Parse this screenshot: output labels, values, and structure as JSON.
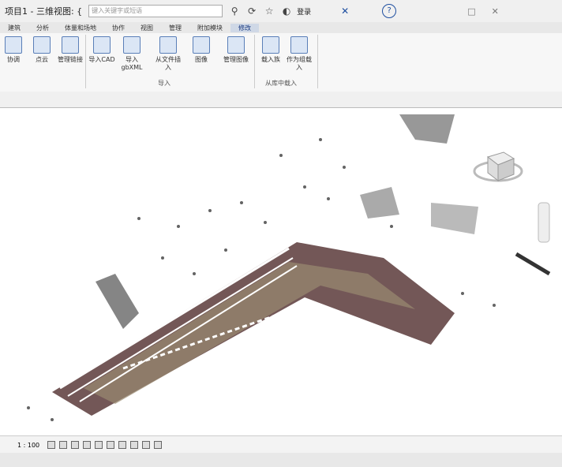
{
  "titlebar": {
    "title": "项目1 - 三维视图: {",
    "search_placeholder": "键入关键字或短语",
    "login": "登录",
    "help_icon": "?"
  },
  "tabs": [
    "建筑",
    "分析",
    "体量和场地",
    "协作",
    "视图",
    "管理",
    "附加模块",
    "修改"
  ],
  "ribbon": {
    "buttons": [
      {
        "label": "协调",
        "icon": "coordinate-icon"
      },
      {
        "label": "点云",
        "icon": "pointcloud-icon"
      },
      {
        "label": "管理链接",
        "icon": "link-manage-icon"
      },
      {
        "label": "导入CAD",
        "icon": "import-cad-icon"
      },
      {
        "label": "导入gbXML",
        "icon": "import-gbxml-icon"
      },
      {
        "label": "从文件插入",
        "icon": "insert-file-icon"
      },
      {
        "label": "图像",
        "icon": "image-icon"
      },
      {
        "label": "管理图像",
        "icon": "manage-image-icon"
      },
      {
        "label": "载入族",
        "icon": "load-family-icon"
      },
      {
        "label": "作为组载入",
        "icon": "load-group-icon"
      }
    ],
    "groups": [
      "导入",
      "从库中载入"
    ]
  },
  "statusbar": {
    "scale": "1 : 100"
  }
}
